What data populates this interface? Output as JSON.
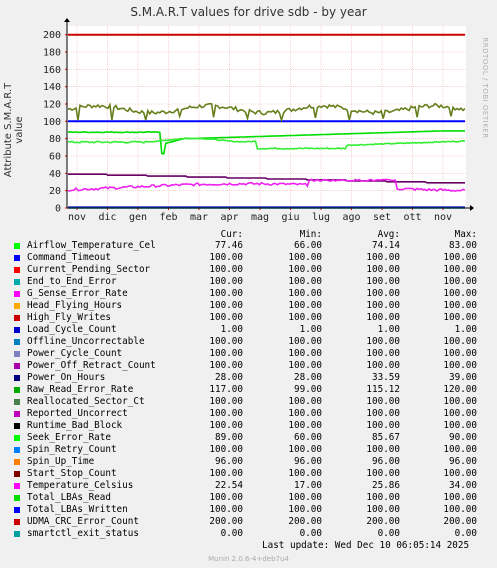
{
  "chart_data": {
    "type": "line",
    "title": "S.M.A.R.T values for drive sdb - by year",
    "ylabel": "Attribute S.M.A.R.T value",
    "side_label": "RRDTOOL / TOBI OETIKER",
    "ylim": [
      0,
      210
    ],
    "yticks": [
      0,
      20,
      40,
      60,
      80,
      100,
      120,
      140,
      160,
      180,
      200
    ],
    "xticks": [
      "nov",
      "dic",
      "gen",
      "feb",
      "mar",
      "apr",
      "mag",
      "giu",
      "lug",
      "ago",
      "set",
      "ott",
      "nov"
    ],
    "grid": true,
    "legend_columns": [
      "Cur:",
      "Min:",
      "Avg:",
      "Max:"
    ],
    "series": [
      {
        "name": "Airflow_Temperature_Cel",
        "color": "#00cc00",
        "cur": "77.46",
        "min": "66.00",
        "avg": "74.14",
        "max": "83.00"
      },
      {
        "name": "Command_Timeout",
        "color": "#0066b3",
        "cur": "100.00",
        "min": "100.00",
        "avg": "100.00",
        "max": "100.00"
      },
      {
        "name": "Current_Pending_Sector",
        "color": "#ff8000",
        "cur": "100.00",
        "min": "100.00",
        "avg": "100.00",
        "max": "100.00"
      },
      {
        "name": "End_to_End_Error",
        "color": "#ffcc00",
        "cur": "100.00",
        "min": "100.00",
        "avg": "100.00",
        "max": "100.00"
      },
      {
        "name": "G_Sense_Error_Rate",
        "color": "#330099",
        "cur": "100.00",
        "min": "100.00",
        "avg": "100.00",
        "max": "100.00"
      },
      {
        "name": "Head_Flying_Hours",
        "color": "#990099",
        "cur": "100.00",
        "min": "100.00",
        "avg": "100.00",
        "max": "100.00"
      },
      {
        "name": "High_Fly_Writes",
        "color": "#ccff00",
        "cur": "100.00",
        "min": "100.00",
        "avg": "100.00",
        "max": "100.00"
      },
      {
        "name": "Load_Cycle_Count",
        "color": "#ff0000",
        "cur": "1.00",
        "min": "1.00",
        "avg": "1.00",
        "max": "1.00"
      },
      {
        "name": "Offline_Uncorrectable",
        "color": "#808080",
        "cur": "100.00",
        "min": "100.00",
        "avg": "100.00",
        "max": "100.00"
      },
      {
        "name": "Power_Cycle_Count",
        "color": "#008f00",
        "cur": "100.00",
        "min": "100.00",
        "avg": "100.00",
        "max": "100.00"
      },
      {
        "name": "Power_Off_Retract_Count",
        "color": "#00487d",
        "cur": "100.00",
        "min": "100.00",
        "avg": "100.00",
        "max": "100.00"
      },
      {
        "name": "Power_On_Hours",
        "color": "#b35a00",
        "cur": "28.00",
        "min": "28.00",
        "avg": "33.59",
        "max": "39.00"
      },
      {
        "name": "Raw_Read_Error_Rate",
        "color": "#b38f00",
        "cur": "117.00",
        "min": "99.00",
        "avg": "115.12",
        "max": "120.00"
      },
      {
        "name": "Reallocated_Sector_Ct",
        "color": "#6b006b",
        "cur": "100.00",
        "min": "100.00",
        "avg": "100.00",
        "max": "100.00"
      },
      {
        "name": "Reported_Uncorrect",
        "color": "#8fb300",
        "cur": "100.00",
        "min": "100.00",
        "avg": "100.00",
        "max": "100.00"
      },
      {
        "name": "Runtime_Bad_Block",
        "color": "#b30000",
        "cur": "100.00",
        "min": "100.00",
        "avg": "100.00",
        "max": "100.00"
      },
      {
        "name": "Seek_Error_Rate",
        "color": "#bebebe",
        "cur": "89.00",
        "min": "60.00",
        "avg": "85.67",
        "max": "90.00"
      },
      {
        "name": "Spin_Retry_Count",
        "color": "#80ff80",
        "cur": "100.00",
        "min": "100.00",
        "avg": "100.00",
        "max": "100.00"
      },
      {
        "name": "Spin_Up_Time",
        "color": "#80c9ff",
        "cur": "96.00",
        "min": "96.00",
        "avg": "96.00",
        "max": "96.00"
      },
      {
        "name": "Start_Stop_Count",
        "color": "#ffc080",
        "cur": "100.00",
        "min": "100.00",
        "avg": "100.00",
        "max": "100.00"
      },
      {
        "name": "Temperature_Celsius",
        "color": "#ffe680",
        "cur": "22.54",
        "min": "17.00",
        "avg": "25.86",
        "max": "34.00"
      },
      {
        "name": "Total_LBAs_Read",
        "color": "#aa80ff",
        "cur": "100.00",
        "min": "100.00",
        "avg": "100.00",
        "max": "100.00"
      },
      {
        "name": "Total_LBAs_Written",
        "color": "#ee00cc",
        "cur": "100.00",
        "min": "100.00",
        "avg": "100.00",
        "max": "100.00"
      },
      {
        "name": "UDMA_CRC_Error_Count",
        "color": "#ff8080",
        "cur": "200.00",
        "min": "200.00",
        "avg": "200.00",
        "max": "200.00"
      },
      {
        "name": "smartctl_exit_status",
        "color": "#666600",
        "cur": "0.00",
        "min": "0.00",
        "avg": "0.00",
        "max": "0.00"
      }
    ],
    "legend_colors": [
      "#00ff00",
      "#0000ff",
      "#ff0000",
      "#00aaaa",
      "#ff00ff",
      "#ffaa00",
      "#cc0000",
      "#0000cc",
      "#0080c0",
      "#8080c0",
      "#aa00aa",
      "#000080",
      "#00aa00",
      "#4a7f4a",
      "#c000c0",
      "#000000",
      "#00ff00",
      "#0080ff",
      "#ff8000",
      "#800000",
      "#ff00ff",
      "#00dd00",
      "#0000ff",
      "#cc0000",
      "#00a0a0"
    ]
  },
  "footer": {
    "last_update": "Last update:  Wed Dec 10 06:05:14 2025",
    "generator": "Munin 2.0.6-4+deb7u4"
  }
}
